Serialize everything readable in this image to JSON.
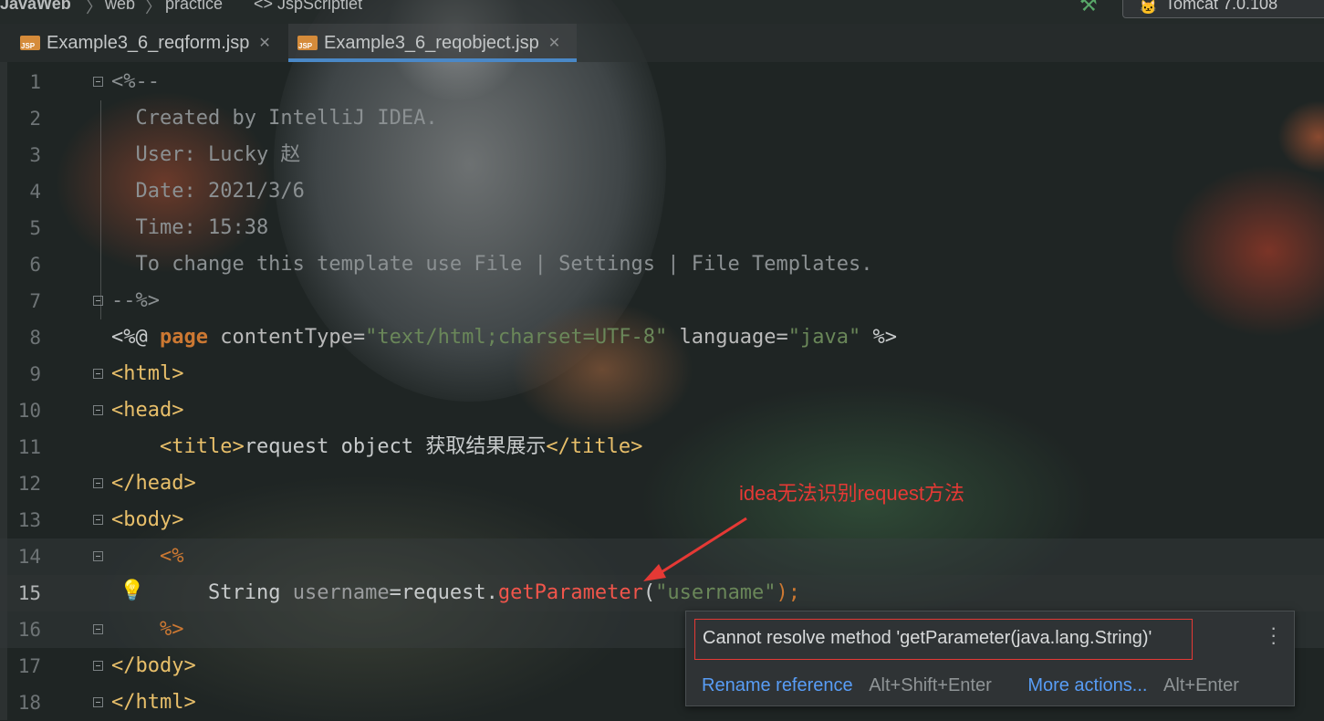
{
  "breadcrumb": {
    "items": [
      "JavaWeb",
      "web",
      "practice",
      "JspScriptlet"
    ],
    "separator": "〉"
  },
  "run_config": {
    "label": "Tomcat 7.0.108"
  },
  "tabs": [
    {
      "label": "Example3_6_reqform.jsp",
      "active": false
    },
    {
      "label": "Example3_6_reqobject.jsp",
      "active": true
    }
  ],
  "file_badge": "JSP",
  "editor": {
    "lines": [
      {
        "num": "1",
        "text": "<%--"
      },
      {
        "num": "2",
        "text": "  Created by IntelliJ IDEA."
      },
      {
        "num": "3",
        "text": "  User: Lucky 赵"
      },
      {
        "num": "4",
        "text": "  Date: 2021/3/6"
      },
      {
        "num": "5",
        "text": "  Time: 15:38"
      },
      {
        "num": "6",
        "text": "  To change this template use File | Settings | File Templates."
      },
      {
        "num": "7",
        "text": "--%>"
      },
      {
        "num": "8",
        "text": "<%@ page contentType=\"text/html;charset=UTF-8\" language=\"java\" %>"
      },
      {
        "num": "9",
        "text": "<html>"
      },
      {
        "num": "10",
        "text": "<head>"
      },
      {
        "num": "11",
        "text": "    <title>request object 获取结果展示</title>"
      },
      {
        "num": "12",
        "text": "</head>"
      },
      {
        "num": "13",
        "text": "<body>"
      },
      {
        "num": "14",
        "text": "    <%"
      },
      {
        "num": "15",
        "text": "        String username=request.getParameter(\"username\");"
      },
      {
        "num": "16",
        "text": "    %>"
      },
      {
        "num": "17",
        "text": "</body>"
      },
      {
        "num": "18",
        "text": "</html>"
      }
    ],
    "tokens": {
      "l8_open": "<%@ ",
      "l8_kw": "page",
      "l8_attr1": " contentType=",
      "l8_val1": "\"text/html;charset=UTF-8\"",
      "l8_attr2": " language=",
      "l8_val2": "\"java\"",
      "l8_close": " %>",
      "l11_indent": "    ",
      "l11_open": "<title>",
      "l11_text": "request object 获取结果展示",
      "l11_close": "</title>",
      "l14": "    <%",
      "l15_indent": "        ",
      "l15_type": "String",
      "l15_var": " username",
      "l15_eq": "=request.",
      "l15_method": "getParameter",
      "l15_paren": "(",
      "l15_str": "\"username\"",
      "l15_end": ");",
      "l16": "    %>"
    }
  },
  "annotation": {
    "text": "idea无法识别request方法",
    "color": "#e53935"
  },
  "popup": {
    "message": "Cannot resolve method 'getParameter(java.lang.String)'",
    "actions": [
      {
        "label": "Rename reference",
        "shortcut": "Alt+Shift+Enter"
      },
      {
        "label": "More actions...",
        "shortcut": "Alt+Enter"
      }
    ]
  },
  "colors": {
    "accent": "#4a88c7",
    "error": "#f0554b",
    "link": "#589df6"
  }
}
